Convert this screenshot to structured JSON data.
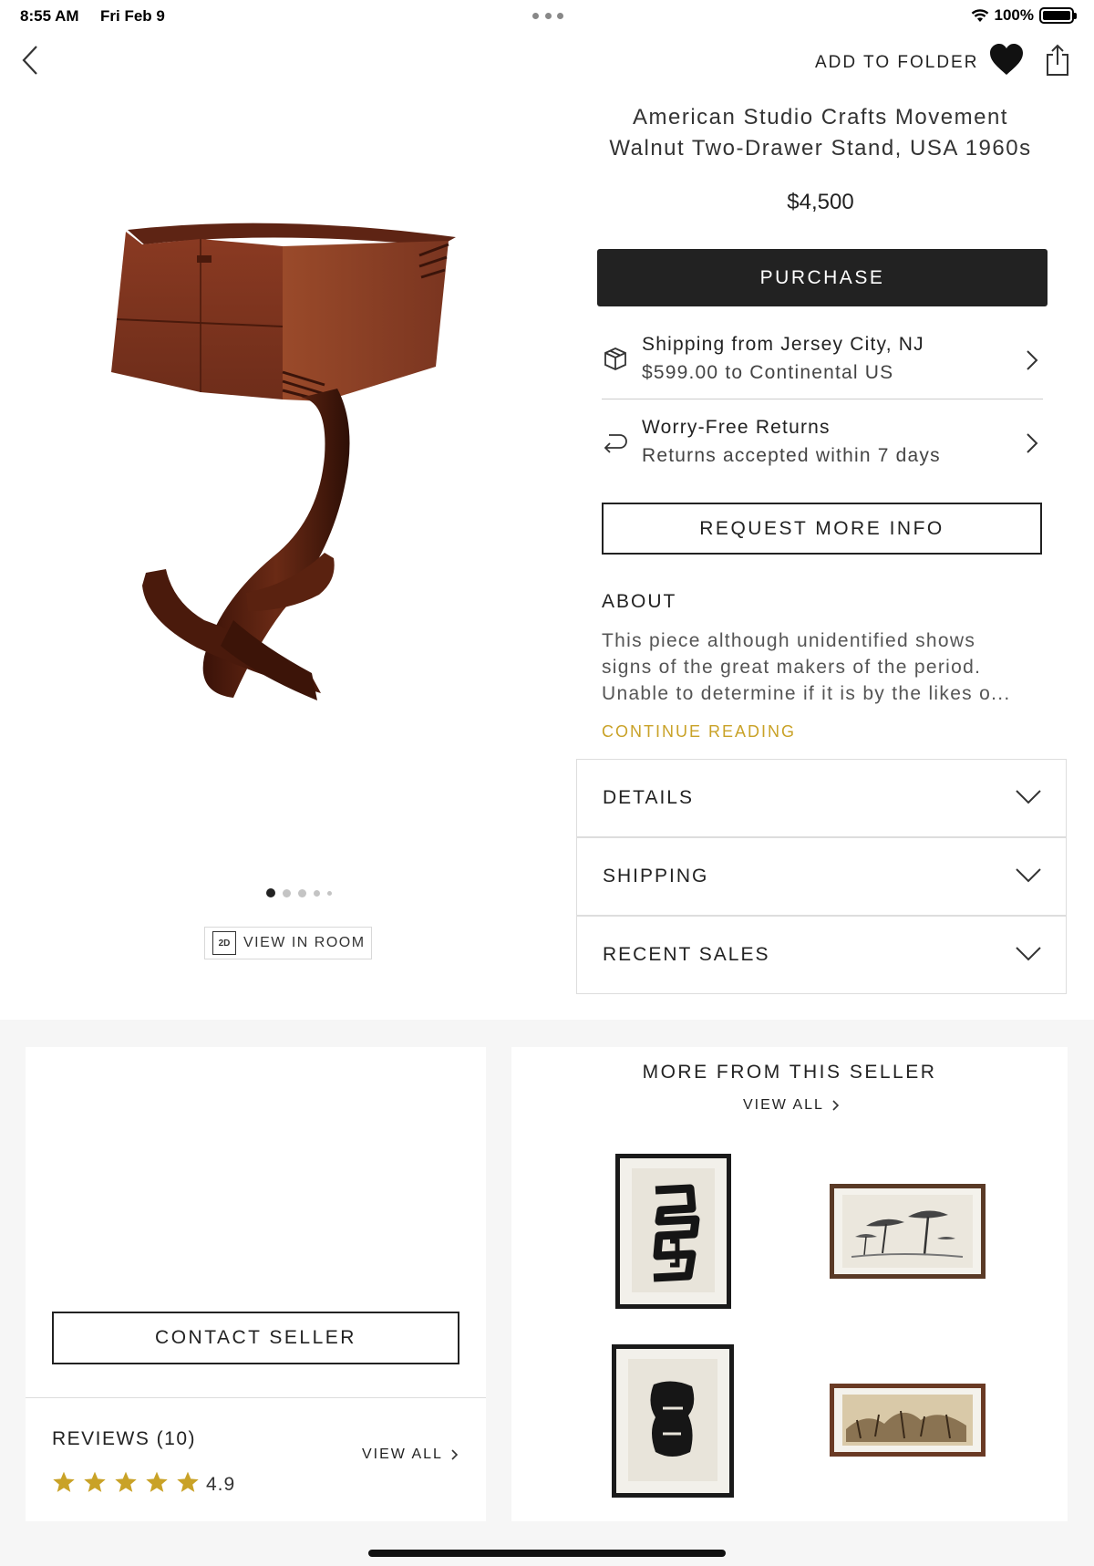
{
  "status_bar": {
    "time": "8:55 AM",
    "date": "Fri Feb 9",
    "battery": "100%"
  },
  "nav": {
    "add_to_folder": "ADD TO FOLDER"
  },
  "product": {
    "title_line1": "American Studio Crafts Movement",
    "title_line2": "Walnut Two-Drawer Stand, USA 1960s",
    "price": "$4,500",
    "purchase_label": "PURCHASE",
    "image_count": 5,
    "current_image": 1,
    "view_in_room_label": "VIEW IN ROOM",
    "view_in_room_icon": "2D"
  },
  "shipping": {
    "line1": "Shipping from Jersey City, NJ",
    "line2": "$599.00 to Continental US"
  },
  "returns": {
    "line1": "Worry-Free Returns",
    "line2": "Returns accepted within 7 days"
  },
  "request_info_label": "REQUEST MORE INFO",
  "about": {
    "heading": "ABOUT",
    "line1": "This piece although unidentified shows",
    "line2": "signs of the great makers of the period.",
    "line3": "Unable to determine if it is by the likes o...",
    "continue_label": "CONTINUE READING"
  },
  "accordions": {
    "details": "DETAILS",
    "shipping": "SHIPPING",
    "recent_sales": "RECENT SALES"
  },
  "seller": {
    "contact_label": "CONTACT SELLER",
    "reviews_heading": "REVIEWS (10)",
    "reviews_view_all": "VIEW ALL",
    "rating": "4.9",
    "stars": 5
  },
  "more_from_seller": {
    "heading": "MORE FROM THIS SELLER",
    "view_all": "VIEW ALL"
  },
  "colors": {
    "accent_gold": "#c9a227",
    "dark_button": "#222222",
    "star": "#c9a227"
  }
}
